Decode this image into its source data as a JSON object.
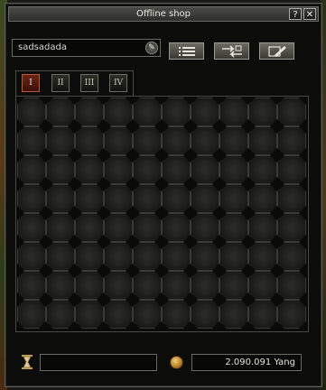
{
  "window": {
    "title": "Offline shop",
    "help_label": "?",
    "close_label": "✕"
  },
  "shop": {
    "name": "sadsadada",
    "edit_icon": "pencil-icon"
  },
  "toolbar": {
    "list_icon": "list-icon",
    "transfer_icon": "transfer-icon",
    "edit_icon": "edit-shop-icon"
  },
  "pages": {
    "labels": [
      "I",
      "II",
      "III",
      "IV"
    ],
    "active": "I"
  },
  "inventory": {
    "columns": 10,
    "rows": 8
  },
  "footer": {
    "time_icon": "hourglass-icon",
    "time_value": "",
    "currency_icon": "coin-icon",
    "yang": "2.090.091 Yang"
  },
  "colors": {
    "active_tab": "#6a2418",
    "window_bg": "#0c0c0a"
  }
}
